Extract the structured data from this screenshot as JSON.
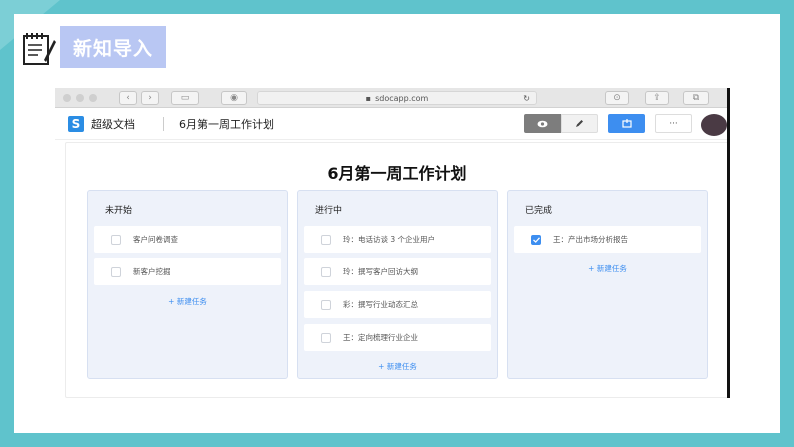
{
  "slide": {
    "title": "新知导入"
  },
  "browser": {
    "url": "sdocapp.com",
    "app_name": "超级文档",
    "logo_letter": "S",
    "doc_title": "6月第一周工作计划",
    "toolbar_icons": [
      "eye-icon",
      "pencil-icon",
      "share-icon",
      "more-icon"
    ],
    "toolbar_more": "···"
  },
  "doc": {
    "heading": "6月第一周工作计划",
    "columns": [
      {
        "title": "未开始",
        "tasks": [
          {
            "text": "客户问卷调查",
            "done": false
          },
          {
            "text": "新客户挖掘",
            "done": false
          }
        ],
        "new_task": "+ 新建任务"
      },
      {
        "title": "进行中",
        "tasks": [
          {
            "text": "玲：电话访谈 3 个企业用户",
            "done": false
          },
          {
            "text": "玲：撰写客户回访大纲",
            "done": false
          },
          {
            "text": "彩：撰写行业动态汇总",
            "done": false
          },
          {
            "text": "王：定向梳理行业企业",
            "done": false
          }
        ],
        "new_task": "+ 新建任务"
      },
      {
        "title": "已完成",
        "tasks": [
          {
            "text": "王：产出市场分析报告",
            "done": true
          }
        ],
        "new_task": "+ 新建任务"
      }
    ]
  },
  "colors": {
    "background": "#5fc3cc",
    "title_box": "#b9c7f3",
    "accent": "#3d8ef0"
  }
}
